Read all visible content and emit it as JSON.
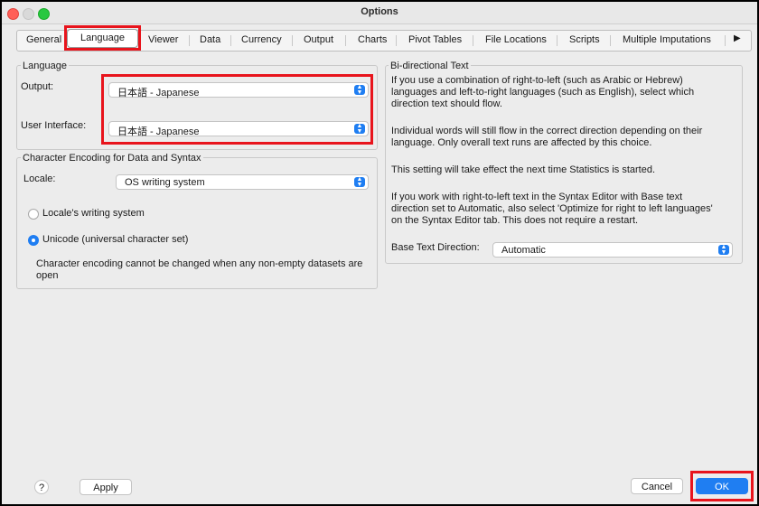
{
  "window": {
    "title": "Options"
  },
  "tabs": [
    "General",
    "Language",
    "Viewer",
    "Data",
    "Currency",
    "Output",
    "Charts",
    "Pivot Tables",
    "File Locations",
    "Scripts",
    "Multiple Imputations"
  ],
  "tabs_more_icon": "▶",
  "active_tab": "Language",
  "language": {
    "group_title": "Language",
    "output_label": "Output:",
    "output_value": "日本語 - Japanese",
    "ui_label": "User Interface:",
    "ui_value": "日本語 - Japanese"
  },
  "encoding": {
    "group_title": "Character Encoding for Data and Syntax",
    "locale_label": "Locale:",
    "locale_value": "OS writing system",
    "radio_locale": "Locale's writing system",
    "radio_unicode": "Unicode (universal character set)",
    "selected": "Unicode (universal character set)",
    "note_line1": "Character encoding cannot be changed when any non-empty datasets are",
    "note_line2": "open"
  },
  "bidi": {
    "group_title": "Bi-directional Text",
    "p1": [
      "If you use a combination of right-to-left (such as Arabic or Hebrew)",
      "languages and left-to-right languages (such as English), select which",
      "direction text should flow."
    ],
    "p2": [
      "Individual words will still flow in the correct direction depending on their",
      "language. Only overall text runs are affected by this choice."
    ],
    "p3": [
      "This setting will take effect the next time Statistics is started."
    ],
    "p4": [
      "If you work with right-to-left text in the Syntax Editor with Base text",
      "direction set to Automatic, also select 'Optimize for right to left languages'",
      "on the Syntax Editor tab. This does not require a restart."
    ],
    "base_label": "Base Text Direction:",
    "base_value": "Automatic"
  },
  "footer": {
    "help": "?",
    "apply": "Apply",
    "cancel": "Cancel",
    "ok": "OK"
  },
  "colors": {
    "highlight": "#e8141c",
    "accent": "#1f7ef2"
  }
}
